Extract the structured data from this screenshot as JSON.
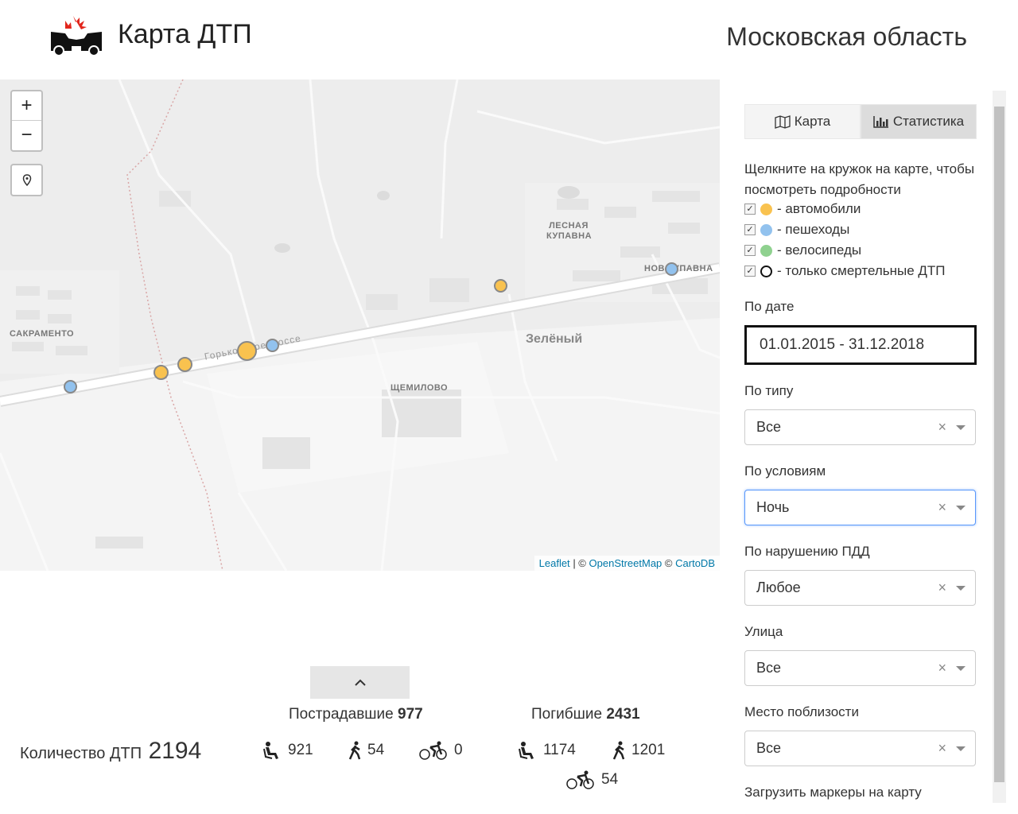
{
  "header": {
    "app_title": "Карта ДТП",
    "region": "Московская область"
  },
  "map": {
    "zoom_in": "+",
    "zoom_out": "−",
    "labels": {
      "sakramento": "САКРАМЕНТО",
      "lesnaya_kupavna": "ЛЕСНАЯ КУПАВНА",
      "novaya_kupavna": "НОВ КУПАВНА",
      "zeleny": "Зелёный",
      "shchemilovo": "ЩЕМИЛОВО",
      "road": "Горьковское шоссе"
    },
    "attribution": {
      "leaflet": "Leaflet",
      "sep": "| ©",
      "osm": "OpenStreetMap",
      "copy2": "©",
      "carto": "CartoDB"
    },
    "marker_colors": {
      "cars": "#f9c24f",
      "pedestrians": "#92c2ee",
      "bicycles": "#8fd18f"
    }
  },
  "stats": {
    "count_label": "Количество ДТП",
    "count_value": "2194",
    "injured_label": "Пострадавшие",
    "injured_total": "977",
    "killed_label": "Погибшие",
    "killed_total": "2431",
    "injured": {
      "drivers": "921",
      "pedestrians": "54",
      "cyclists": "0"
    },
    "killed": {
      "drivers": "1174",
      "pedestrians": "1201",
      "cyclists": "54"
    }
  },
  "sidebar": {
    "tabs": [
      {
        "label": "Карта",
        "icon": "map-icon"
      },
      {
        "label": "Статистика",
        "icon": "bar-chart-icon"
      }
    ],
    "hint": "Щелкните на кружок на карте, чтобы посмотреть подробности",
    "legend": [
      {
        "label": "- автомобили",
        "color": "#f9c24f"
      },
      {
        "label": "- пешеходы",
        "color": "#92c2ee"
      },
      {
        "label": "- велосипеды",
        "color": "#8fd18f"
      },
      {
        "label": "- только смертельные ДТП",
        "color": "#ffffff"
      }
    ],
    "date_label": "По дате",
    "date_value": "01.01.2015 - 31.12.2018",
    "type_label": "По типу",
    "type_value": "Все",
    "conditions_label": "По условиям",
    "conditions_value": "Ночь",
    "violation_label": "По нарушению ПДД",
    "violation_value": "Любое",
    "street_label": "Улица",
    "street_value": "Все",
    "nearby_label": "Место поблизости",
    "nearby_value": "Все",
    "load_markers_label": "Загрузить маркеры на карту"
  }
}
